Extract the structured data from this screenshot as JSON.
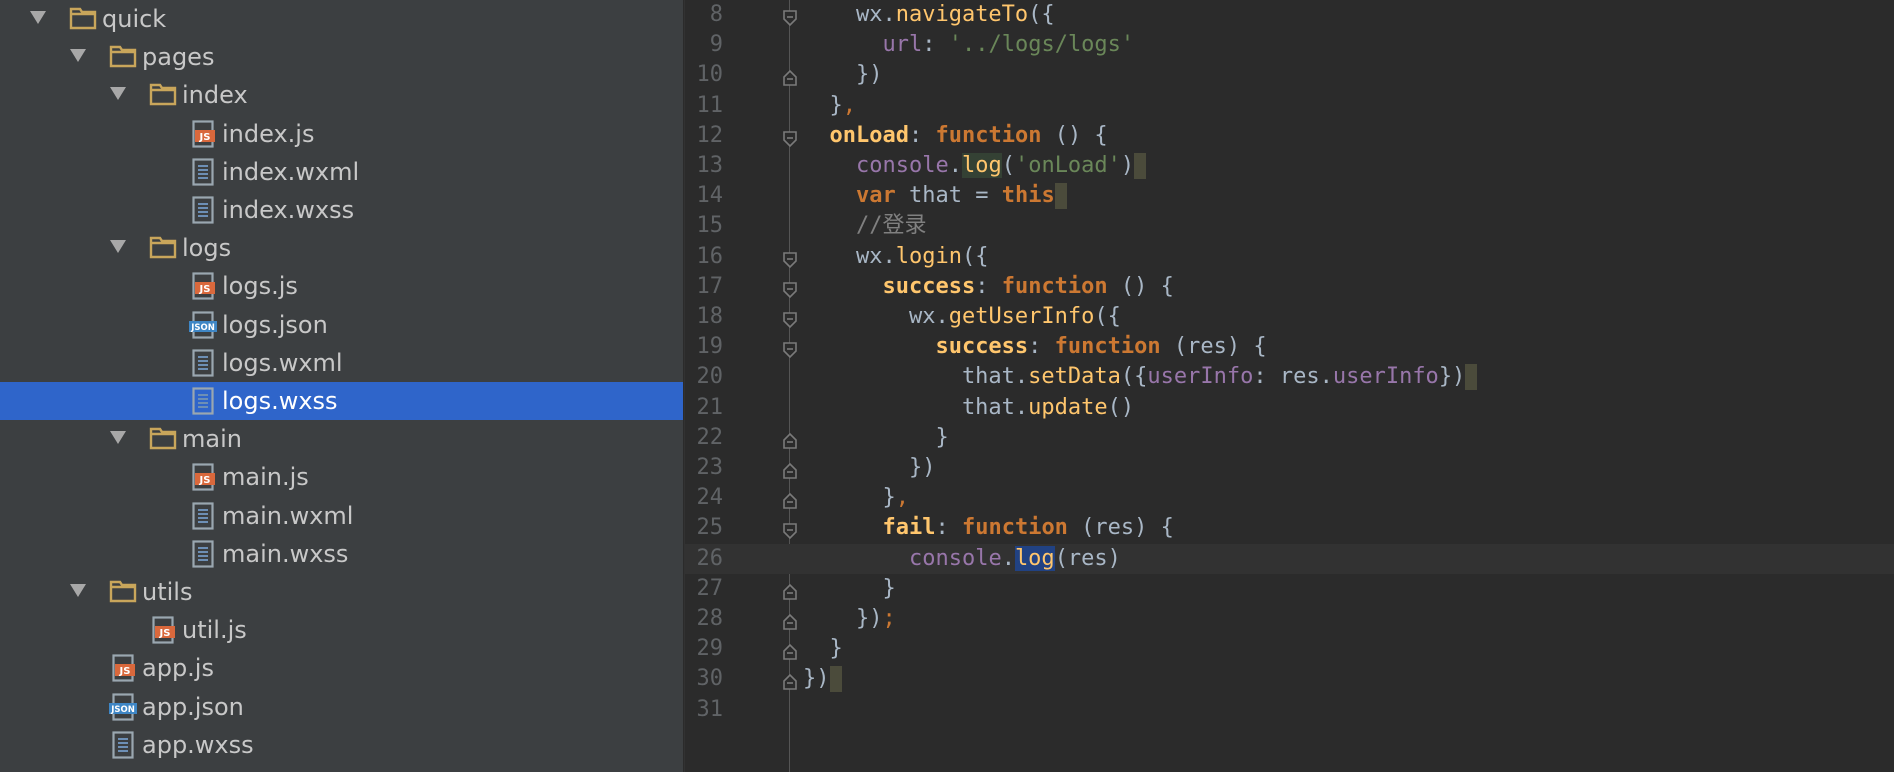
{
  "file_tree": {
    "items": [
      {
        "label": "quick",
        "type": "folder",
        "expanded": true,
        "depth": 0
      },
      {
        "label": "pages",
        "type": "folder",
        "expanded": true,
        "depth": 1
      },
      {
        "label": "index",
        "type": "folder",
        "expanded": true,
        "depth": 2
      },
      {
        "label": "index.js",
        "type": "js",
        "depth": 3
      },
      {
        "label": "index.wxml",
        "type": "text",
        "depth": 3
      },
      {
        "label": "index.wxss",
        "type": "text",
        "depth": 3
      },
      {
        "label": "logs",
        "type": "folder",
        "expanded": true,
        "depth": 2
      },
      {
        "label": "logs.js",
        "type": "js",
        "depth": 3
      },
      {
        "label": "logs.json",
        "type": "json",
        "depth": 3
      },
      {
        "label": "logs.wxml",
        "type": "text",
        "depth": 3
      },
      {
        "label": "logs.wxss",
        "type": "text",
        "depth": 3,
        "selected": true
      },
      {
        "label": "main",
        "type": "folder",
        "expanded": true,
        "depth": 2
      },
      {
        "label": "main.js",
        "type": "js",
        "depth": 3
      },
      {
        "label": "main.wxml",
        "type": "text",
        "depth": 3
      },
      {
        "label": "main.wxss",
        "type": "text",
        "depth": 3
      },
      {
        "label": "utils",
        "type": "folder",
        "expanded": true,
        "depth": 1
      },
      {
        "label": "util.js",
        "type": "js",
        "depth": 2
      },
      {
        "label": "app.js",
        "type": "js",
        "depth": 1
      },
      {
        "label": "app.json",
        "type": "json",
        "depth": 1
      },
      {
        "label": "app.wxss",
        "type": "text",
        "depth": 1
      }
    ]
  },
  "editor": {
    "current_line": 26,
    "lines": [
      {
        "num": "8",
        "fold": "open",
        "tokens": [
          {
            "t": "    wx.",
            "c": ""
          },
          {
            "t": "navigateTo",
            "c": "t-fn"
          },
          {
            "t": "({",
            "c": ""
          }
        ]
      },
      {
        "num": "9",
        "fold": "",
        "tokens": [
          {
            "t": "      ",
            "c": ""
          },
          {
            "t": "url",
            "c": "t-prop"
          },
          {
            "t": ": ",
            "c": ""
          },
          {
            "t": "'../logs/logs'",
            "c": "t-str"
          }
        ]
      },
      {
        "num": "10",
        "fold": "close",
        "tokens": [
          {
            "t": "    })",
            "c": ""
          }
        ]
      },
      {
        "num": "11",
        "fold": "",
        "tokens": [
          {
            "t": "  }",
            "c": ""
          },
          {
            "t": ",",
            "c": "t-punct"
          }
        ]
      },
      {
        "num": "12",
        "fold": "open",
        "tokens": [
          {
            "t": "  ",
            "c": ""
          },
          {
            "t": "onLoad",
            "c": "t-key"
          },
          {
            "t": ": ",
            "c": ""
          },
          {
            "t": "function",
            "c": "t-kw"
          },
          {
            "t": " () {",
            "c": ""
          }
        ]
      },
      {
        "num": "13",
        "fold": "",
        "tokens": [
          {
            "t": "    ",
            "c": ""
          },
          {
            "t": "console",
            "c": "t-prop"
          },
          {
            "t": ".",
            "c": ""
          },
          {
            "t": "log",
            "c": "t-fn hl-id"
          },
          {
            "t": "(",
            "c": ""
          },
          {
            "t": "'onLoad'",
            "c": "t-str"
          },
          {
            "t": ")",
            "c": ""
          },
          {
            "t": "",
            "c": "eol"
          }
        ]
      },
      {
        "num": "14",
        "fold": "",
        "tokens": [
          {
            "t": "    ",
            "c": ""
          },
          {
            "t": "var",
            "c": "t-kw"
          },
          {
            "t": " that = ",
            "c": ""
          },
          {
            "t": "this",
            "c": "t-kw"
          },
          {
            "t": "",
            "c": "eol"
          }
        ]
      },
      {
        "num": "15",
        "fold": "",
        "tokens": [
          {
            "t": "    //登录",
            "c": "t-cmt"
          }
        ]
      },
      {
        "num": "16",
        "fold": "open",
        "tokens": [
          {
            "t": "    wx.",
            "c": ""
          },
          {
            "t": "login",
            "c": "t-fn"
          },
          {
            "t": "({",
            "c": ""
          }
        ]
      },
      {
        "num": "17",
        "fold": "open",
        "tokens": [
          {
            "t": "      ",
            "c": ""
          },
          {
            "t": "success",
            "c": "t-key"
          },
          {
            "t": ": ",
            "c": ""
          },
          {
            "t": "function",
            "c": "t-kw"
          },
          {
            "t": " () {",
            "c": ""
          }
        ]
      },
      {
        "num": "18",
        "fold": "open",
        "tokens": [
          {
            "t": "        wx.",
            "c": ""
          },
          {
            "t": "getUserInfo",
            "c": "t-fn"
          },
          {
            "t": "({",
            "c": ""
          }
        ]
      },
      {
        "num": "19",
        "fold": "open",
        "tokens": [
          {
            "t": "          ",
            "c": ""
          },
          {
            "t": "success",
            "c": "t-key"
          },
          {
            "t": ": ",
            "c": ""
          },
          {
            "t": "function",
            "c": "t-kw"
          },
          {
            "t": " (res) {",
            "c": ""
          }
        ]
      },
      {
        "num": "20",
        "fold": "",
        "tokens": [
          {
            "t": "            that.",
            "c": ""
          },
          {
            "t": "setData",
            "c": "t-fn"
          },
          {
            "t": "({",
            "c": ""
          },
          {
            "t": "userInfo",
            "c": "t-prop"
          },
          {
            "t": ": res.",
            "c": ""
          },
          {
            "t": "userInfo",
            "c": "t-prop"
          },
          {
            "t": "})",
            "c": ""
          },
          {
            "t": "",
            "c": "eol"
          }
        ]
      },
      {
        "num": "21",
        "fold": "",
        "tokens": [
          {
            "t": "            that.",
            "c": ""
          },
          {
            "t": "update",
            "c": "t-fn"
          },
          {
            "t": "()",
            "c": ""
          }
        ]
      },
      {
        "num": "22",
        "fold": "close",
        "tokens": [
          {
            "t": "          }",
            "c": ""
          }
        ]
      },
      {
        "num": "23",
        "fold": "close",
        "tokens": [
          {
            "t": "        })",
            "c": ""
          }
        ]
      },
      {
        "num": "24",
        "fold": "close",
        "tokens": [
          {
            "t": "      }",
            "c": ""
          },
          {
            "t": ",",
            "c": "t-punct"
          }
        ]
      },
      {
        "num": "25",
        "fold": "open",
        "tokens": [
          {
            "t": "      ",
            "c": ""
          },
          {
            "t": "fail",
            "c": "t-key"
          },
          {
            "t": ": ",
            "c": ""
          },
          {
            "t": "function",
            "c": "t-kw"
          },
          {
            "t": " (res) {",
            "c": ""
          }
        ]
      },
      {
        "num": "26",
        "fold": "",
        "tokens": [
          {
            "t": "        ",
            "c": ""
          },
          {
            "t": "console",
            "c": "t-prop"
          },
          {
            "t": ".",
            "c": ""
          },
          {
            "t": "log",
            "c": "t-fn hl-sel"
          },
          {
            "t": "(res)",
            "c": ""
          }
        ]
      },
      {
        "num": "27",
        "fold": "close",
        "tokens": [
          {
            "t": "      }",
            "c": ""
          }
        ]
      },
      {
        "num": "28",
        "fold": "close",
        "tokens": [
          {
            "t": "    })",
            "c": ""
          },
          {
            "t": ";",
            "c": "t-punct"
          }
        ]
      },
      {
        "num": "29",
        "fold": "close",
        "tokens": [
          {
            "t": "  }",
            "c": ""
          }
        ]
      },
      {
        "num": "30",
        "fold": "close",
        "tokens": [
          {
            "t": "})",
            "c": ""
          },
          {
            "t": "",
            "c": "eol"
          }
        ]
      },
      {
        "num": "31",
        "fold": "",
        "tokens": []
      }
    ]
  }
}
